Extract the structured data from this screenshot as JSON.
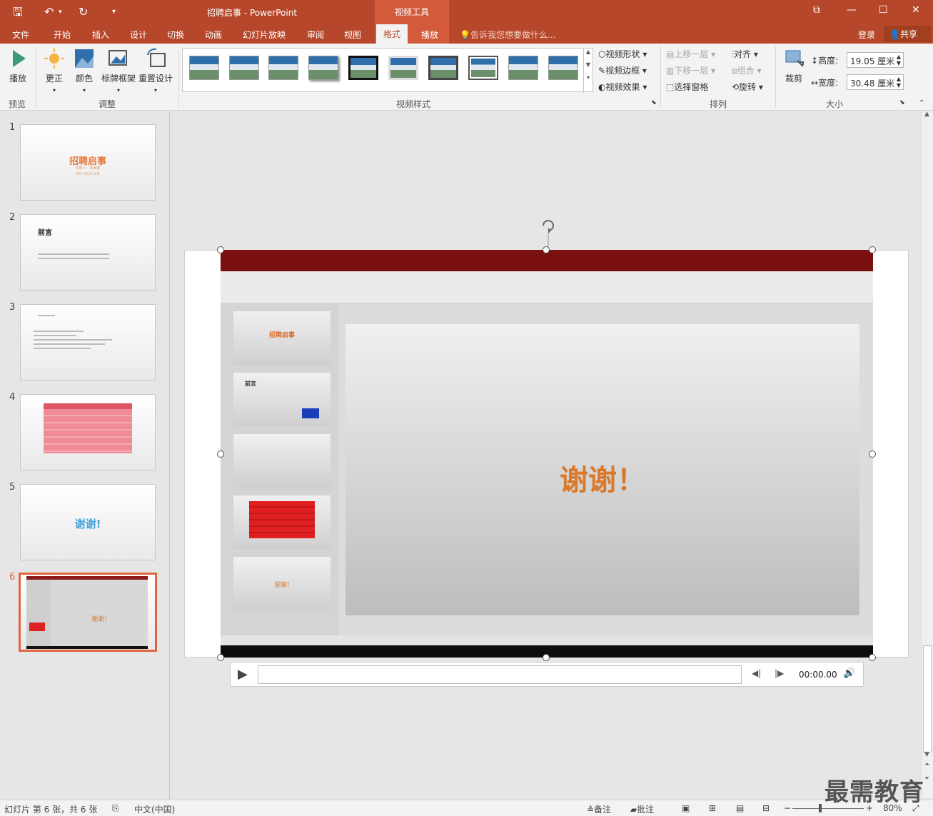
{
  "titlebar": {
    "title": "招聘启事 - PowerPoint",
    "context_tab": "视频工具",
    "undo_label": "↶",
    "redo_label": "↻"
  },
  "tabs": [
    "文件",
    "开始",
    "插入",
    "设计",
    "切换",
    "动画",
    "幻灯片放映",
    "审阅",
    "视图",
    "格式",
    "播放"
  ],
  "active_tab": "格式",
  "tellme": "告诉我您想要做什么...",
  "login": "登录",
  "share": "共享",
  "ribbon": {
    "preview": {
      "play": "播放",
      "group": "预览"
    },
    "adjust": {
      "correct": "更正",
      "color": "颜色",
      "poster": "标牌框架",
      "reset": "重置设计",
      "group": "调整"
    },
    "video_styles": {
      "group": "视频样式",
      "shape": "视频形状",
      "border": "视频边框",
      "effects": "视频效果"
    },
    "arrange": {
      "bring_forward": "上移一层",
      "send_backward": "下移一层",
      "selection_pane": "选择窗格",
      "align": "对齐",
      "group_btn": "组合",
      "rotate": "旋转",
      "group": "排列"
    },
    "size": {
      "crop": "裁剪",
      "height_label": "高度:",
      "height_value": "19.05 厘米",
      "width_label": "宽度:",
      "width_value": "30.48 厘米",
      "group": "大小"
    }
  },
  "slides": [
    {
      "num": "1",
      "title": "招聘启事",
      "line1": "招聘人：某某某",
      "line2": "2017年1月1日"
    },
    {
      "num": "2",
      "title": "前言"
    },
    {
      "num": "3"
    },
    {
      "num": "4"
    },
    {
      "num": "5",
      "title": "谢谢!"
    },
    {
      "num": "6",
      "title": "谢谢!"
    }
  ],
  "video": {
    "caption": "谢谢！",
    "inner_thumb_titles": [
      "招聘启事",
      "前言",
      "",
      "",
      "谢谢!"
    ]
  },
  "player": {
    "time": "00:00.00"
  },
  "status": {
    "slide_info": "幻灯片 第 6 张，共 6 张",
    "language": "中文(中国)",
    "notes": "备注",
    "comments": "批注",
    "zoom": "80%"
  },
  "watermark": "最需教育",
  "colors": {
    "accent": "#b7472a",
    "selected_border": "#e0653f",
    "title_orange": "#e87a3c",
    "thanks_blue": "#4aa3df",
    "video_caption": "#d9792a"
  }
}
